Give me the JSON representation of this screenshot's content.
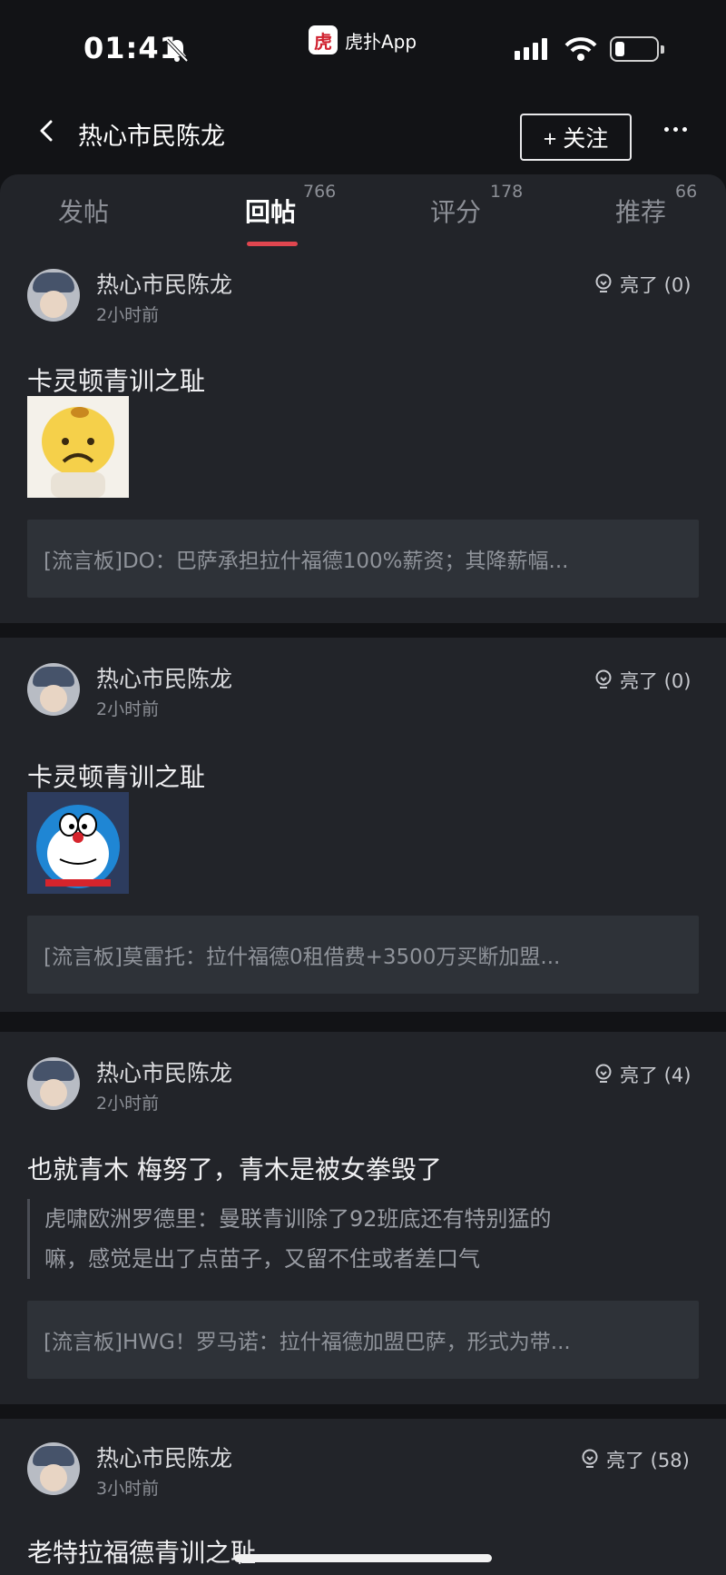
{
  "status_bar": {
    "time": "01:41",
    "app_icon_text": "虎",
    "app_name": "虎扑App"
  },
  "nav": {
    "title": "热心市民陈龙",
    "follow_label": "+ 关注"
  },
  "tabs": [
    {
      "label": "发帖",
      "count": ""
    },
    {
      "label": "回帖",
      "count": "766"
    },
    {
      "label": "评分",
      "count": "178"
    },
    {
      "label": "推荐",
      "count": "66"
    }
  ],
  "posts": [
    {
      "author": "热心市民陈龙",
      "time": "2小时前",
      "light": "亮了 (0)",
      "content": "卡灵顿青训之耻",
      "quote": "[流言板]DO：巴萨承担拉什福德100%薪资；其降薪幅..."
    },
    {
      "author": "热心市民陈龙",
      "time": "2小时前",
      "light": "亮了 (0)",
      "content": "卡灵顿青训之耻",
      "quote": "[流言板]莫雷托：拉什福德0租借费+3500万买断加盟..."
    },
    {
      "author": "热心市民陈龙",
      "time": "2小时前",
      "light": "亮了 (4)",
      "content": "也就青木 梅努了，青木是被女拳毁了",
      "reply_line1": "虎啸欧洲罗德里：曼联青训除了92班底还有特别猛的",
      "reply_line2": "嘛，感觉是出了点苗子，又留不住或者差口气",
      "quote": "[流言板]HWG！罗马诺：拉什福德加盟巴萨，形式为带..."
    },
    {
      "author": "热心市民陈龙",
      "time": "3小时前",
      "light": "亮了 (58)",
      "content": "老特拉福德青训之耻"
    }
  ],
  "colors": {
    "accent": "#e0464f",
    "card": "#222429",
    "background": "#121316"
  }
}
